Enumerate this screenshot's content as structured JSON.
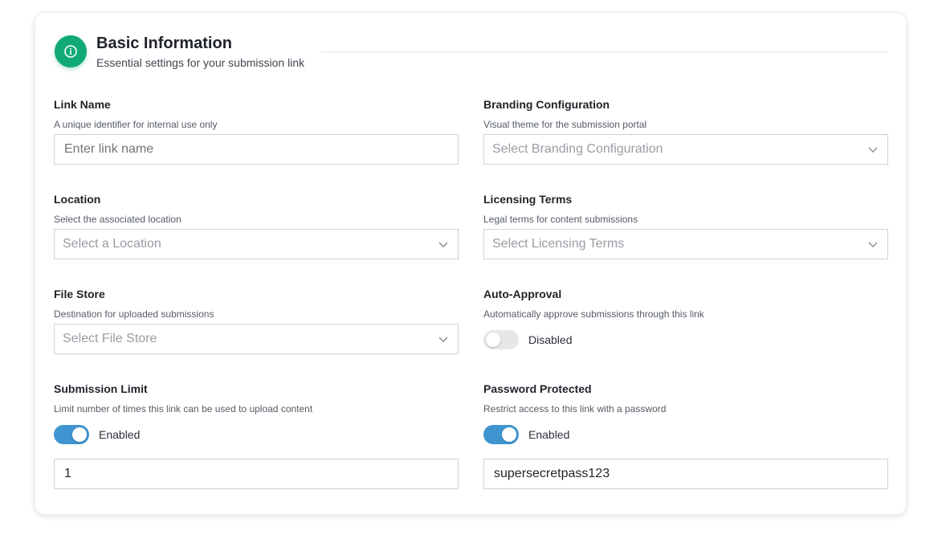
{
  "section": {
    "title": "Basic Information",
    "subtitle": "Essential settings for your submission link",
    "icon": "info-icon",
    "accent": "#12a978"
  },
  "fields": {
    "link_name": {
      "label": "Link Name",
      "description": "A unique identifier for internal use only",
      "placeholder": "Enter link name",
      "value": ""
    },
    "branding": {
      "label": "Branding Configuration",
      "description": "Visual theme for the submission portal",
      "placeholder": "Select Branding Configuration"
    },
    "location": {
      "label": "Location",
      "description": "Select the associated location",
      "placeholder": "Select a Location"
    },
    "licensing": {
      "label": "Licensing Terms",
      "description": "Legal terms for content submissions",
      "placeholder": "Select Licensing Terms"
    },
    "file_store": {
      "label": "File Store",
      "description": "Destination for uploaded submissions",
      "placeholder": "Select File Store"
    },
    "auto_approval": {
      "label": "Auto-Approval",
      "description": "Automatically approve submissions through this link",
      "toggle_state": "Disabled",
      "enabled": false
    },
    "submission_limit": {
      "label": "Submission Limit",
      "description": "Limit number of times this link can be used to upload content",
      "toggle_state": "Enabled",
      "enabled": true,
      "value": "1"
    },
    "password_protected": {
      "label": "Password Protected",
      "description": "Restrict access to this link with a password",
      "toggle_state": "Enabled",
      "enabled": true,
      "value": "supersecretpass123"
    }
  },
  "colors": {
    "toggle_on": "#3f95d0",
    "toggle_off": "#e6e7e9"
  }
}
